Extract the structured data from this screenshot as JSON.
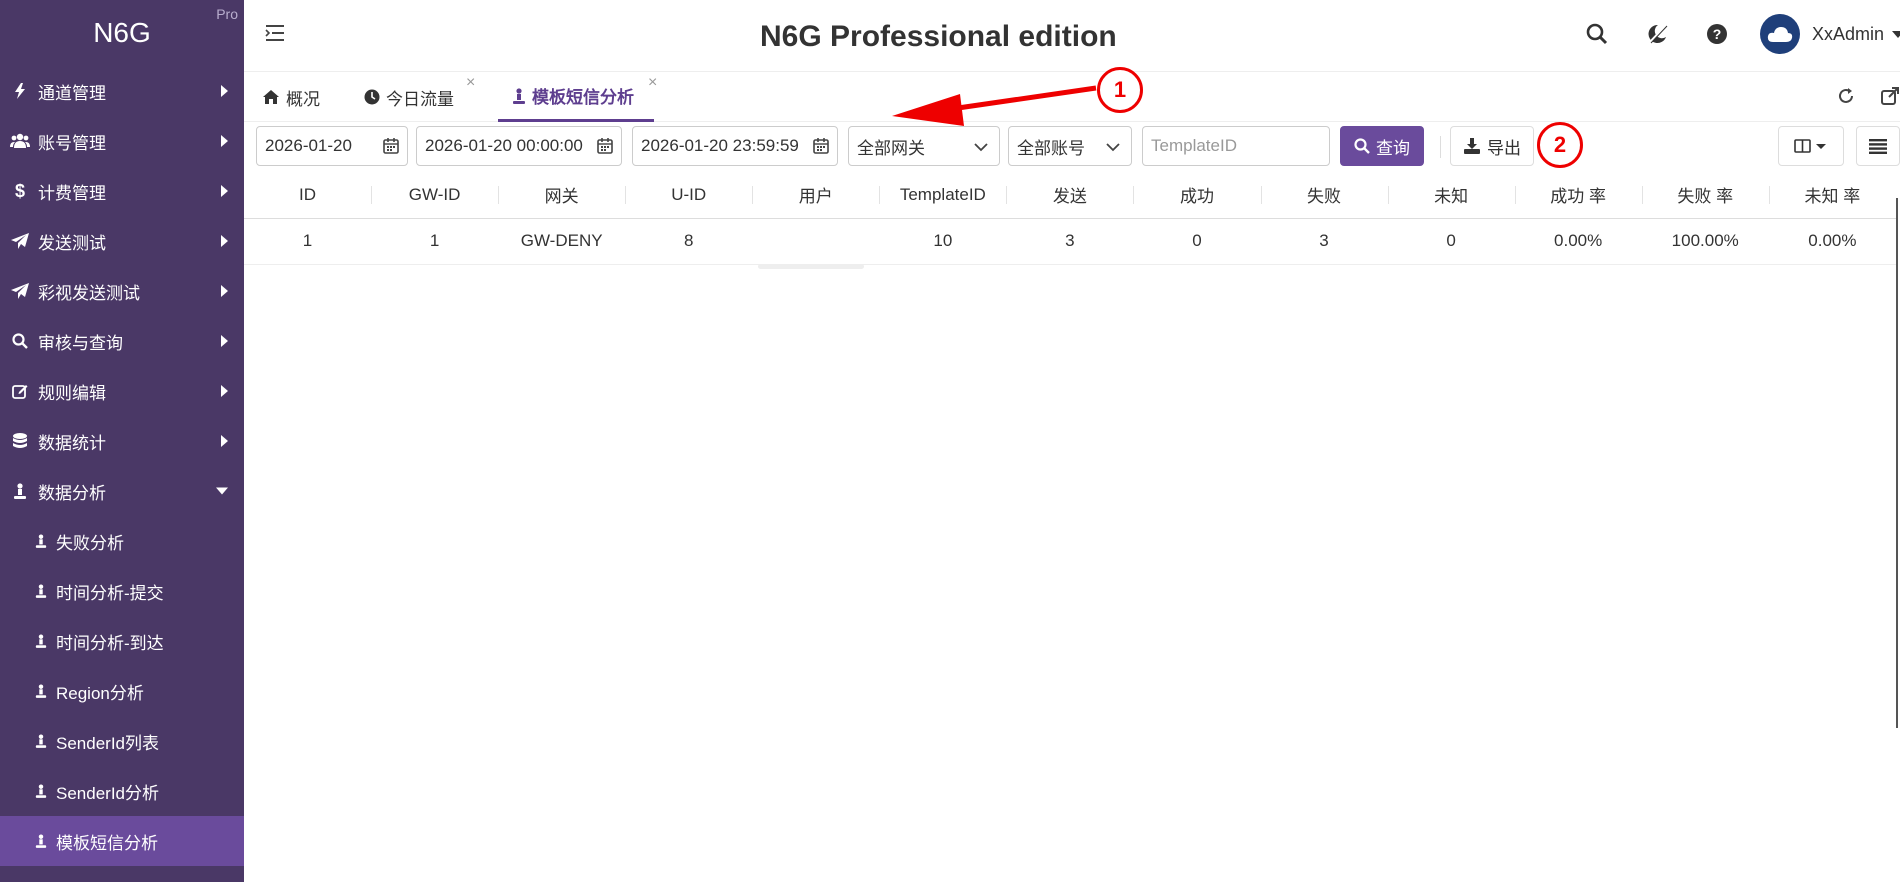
{
  "brand": {
    "name": "N6G",
    "tag": "Pro"
  },
  "sidebar": {
    "items": [
      {
        "label": "通道管理",
        "icon": "bolt-icon"
      },
      {
        "label": "账号管理",
        "icon": "users-icon"
      },
      {
        "label": "计费管理",
        "icon": "dollar-icon"
      },
      {
        "label": "发送测试",
        "icon": "paper-plane-icon"
      },
      {
        "label": "彩视发送测试",
        "icon": "paper-plane-icon"
      },
      {
        "label": "审核与查询",
        "icon": "search-icon"
      },
      {
        "label": "规则编辑",
        "icon": "edit-icon"
      },
      {
        "label": "数据统计",
        "icon": "database-icon"
      },
      {
        "label": "数据分析",
        "icon": "person-icon",
        "expanded": true
      }
    ],
    "sub_items": [
      {
        "label": "失败分析"
      },
      {
        "label": "时间分析-提交"
      },
      {
        "label": "时间分析-到达"
      },
      {
        "label": "Region分析"
      },
      {
        "label": "SenderId列表"
      },
      {
        "label": "SenderId分析"
      },
      {
        "label": "模板短信分析",
        "active": true
      }
    ]
  },
  "header": {
    "title": "N6G Professional edition",
    "user": "XxAdmin"
  },
  "tabs": [
    {
      "label": "概况",
      "icon": "home-icon"
    },
    {
      "label": "今日流量",
      "icon": "clock-icon",
      "closable": true
    },
    {
      "label": "模板短信分析",
      "icon": "person-icon",
      "closable": true,
      "active": true
    }
  ],
  "toolbar": {
    "date": "2026-01-20",
    "start_time": "2026-01-20 00:00:00",
    "end_time": "2026-01-20 23:59:59",
    "gateway": "全部网关",
    "account": "全部账号",
    "template_placeholder": "TemplateID",
    "query_label": "查询",
    "export_label": "导出"
  },
  "table": {
    "headers": [
      "ID",
      "GW-ID",
      "网关",
      "U-ID",
      "用户",
      "TemplateID",
      "发送",
      "成功",
      "失败",
      "未知",
      "成功 率",
      "失败 率",
      "未知 率"
    ],
    "rows": [
      [
        "1",
        "1",
        "GW-DENY",
        "8",
        "",
        "10",
        "3",
        "0",
        "3",
        "0",
        "0.00%",
        "100.00%",
        "0.00%"
      ]
    ]
  },
  "annotations": [
    "1",
    "2"
  ],
  "colors": {
    "sidebar_bg": "#4a3866",
    "accent": "#6a4b9c",
    "annotation": "#e00000"
  }
}
